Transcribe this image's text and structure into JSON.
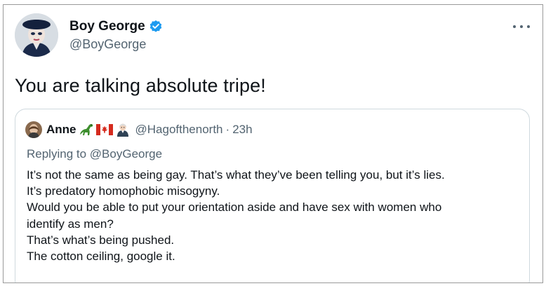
{
  "tweet": {
    "author": {
      "name": "Boy George",
      "handle": "@BoyGeorge",
      "verified": true
    },
    "more_icon": "more-horizontal-icon",
    "text": "You are talking absolute tripe!"
  },
  "quoted": {
    "author": {
      "name": "Anne",
      "handle": "@Hagofthenorth"
    },
    "emojis": [
      "dinosaur-icon",
      "canada-flag-icon",
      "woman-judge-icon"
    ],
    "separator": "·",
    "time": "23h",
    "replying_prefix": "Replying to",
    "replying_to": "@BoyGeorge",
    "lines": [
      "It’s not the same as being gay. That’s what they’ve been telling you, but it’s lies.",
      "It’s predatory homophobic misogyny.",
      "Would you be able to put your orientation aside and have sex with women who",
      "identify as men?",
      "That’s what’s being pushed.",
      "The cotton ceiling, google it."
    ]
  },
  "colors": {
    "text": "#0f1419",
    "secondary": "#536471",
    "verified": "#1d9bf0",
    "border": "#cfd9de"
  }
}
